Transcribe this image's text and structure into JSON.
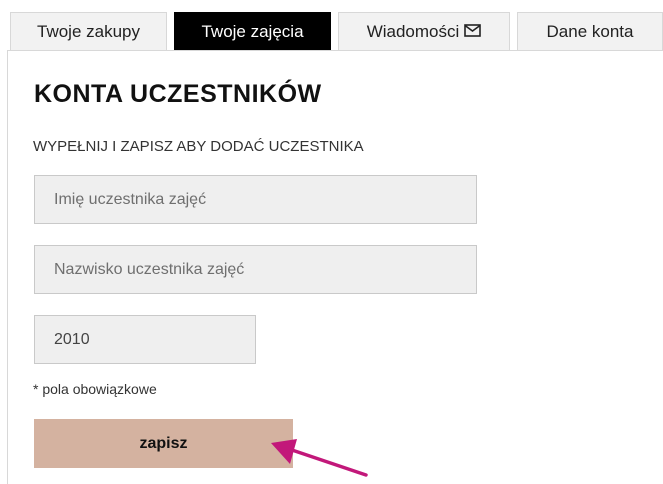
{
  "tabs": [
    {
      "label": "Twoje zakupy",
      "active": false
    },
    {
      "label": "Twoje zajęcia",
      "active": true
    },
    {
      "label": "Wiadomości",
      "active": false,
      "icon": "envelope-icon"
    },
    {
      "label": "Dane konta",
      "active": false
    }
  ],
  "form": {
    "title": "KONTA UCZESTNIKÓW",
    "subtitle": "WYPEŁNIJ I ZAPISZ ABY DODAĆ UCZESTNIKA",
    "first_name_placeholder": "Imię uczestnika zajęć",
    "last_name_placeholder": "Nazwisko uczestnika zajęć",
    "birth_year_value": "2010",
    "required_note": "* pola obowiązkowe",
    "save_label": "zapisz"
  },
  "colors": {
    "active_tab": "#000000",
    "tab_background": "#f2f2f2",
    "save_button": "#d4b2a0",
    "arrow": "#c2187a"
  }
}
